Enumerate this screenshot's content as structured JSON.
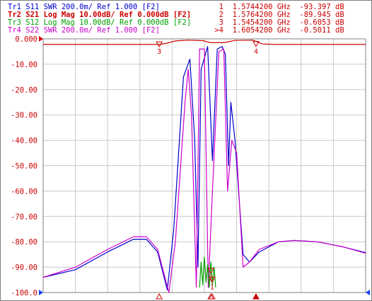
{
  "header": {
    "traces": [
      {
        "id": "Tr1",
        "text": "Tr1 S11 SWR 200.0m/ Ref 1.000 [F2]",
        "color": "#0000cc",
        "active": false
      },
      {
        "id": "Tr2",
        "text": "Tr2 S21 Log Mag 10.00dB/ Ref 0.000dB [F2]",
        "color": "#cc0000",
        "active": true
      },
      {
        "id": "Tr3",
        "text": "Tr3 S12 Log Mag 10.00dB/ Ref 0.000dB [F2]",
        "color": "#00a000",
        "active": false
      },
      {
        "id": "Tr4",
        "text": "Tr4 S22 SWR 200.0m/ Ref 1.000 [F2]",
        "color": "#cc00cc",
        "active": false
      }
    ],
    "markers": [
      {
        "num": "1",
        "freq": "1.5744200 GHz",
        "value": "-93.397 dB"
      },
      {
        "num": "2",
        "freq": "1.5764200 GHz",
        "value": "-89.945 dB"
      },
      {
        "num": "3",
        "freq": "1.5454200 GHz",
        "value": "-0.6053 dB"
      },
      {
        "num": ">4",
        "freq": "1.6054200 GHz",
        "value": "-0.5011 dB"
      }
    ]
  },
  "colors": {
    "s11": "#0000cc",
    "s21": "#cc0000",
    "s12": "#00a000",
    "s22": "#cc00cc",
    "grid": "#c8c8c8",
    "axis_text": "#cc0000",
    "ref_arrow": "#1040ff"
  },
  "chart_data": {
    "type": "line",
    "title": "",
    "xlabel": "",
    "ylabel": "",
    "ylim": [
      -100,
      0
    ],
    "xlim": [
      0,
      10
    ],
    "grid": true,
    "y_ticks": [
      "0.000",
      "-10.00",
      "-20.00",
      "-30.00",
      "-40.00",
      "-50.00",
      "-60.00",
      "-70.00",
      "-80.00",
      "-90.00",
      "-100.0"
    ],
    "series": [
      {
        "name": "S21",
        "color": "#cc0000",
        "points": [
          [
            0,
            -2.2
          ],
          [
            3.6,
            -2.2
          ],
          [
            3.8,
            -1.8
          ],
          [
            4.1,
            -0.8
          ],
          [
            4.5,
            -0.5
          ],
          [
            4.95,
            -0.7
          ],
          [
            5.2,
            -1.5
          ],
          [
            5.6,
            -1.5
          ],
          [
            5.95,
            -0.6
          ],
          [
            6.5,
            -0.5
          ],
          [
            6.8,
            -2
          ],
          [
            7.2,
            -2.2
          ],
          [
            10,
            -2.2
          ]
        ]
      },
      {
        "name": "S11",
        "color": "#0000cc",
        "points": [
          [
            0,
            -94
          ],
          [
            1,
            -91
          ],
          [
            2,
            -84
          ],
          [
            2.8,
            -79
          ],
          [
            3.2,
            -79
          ],
          [
            3.55,
            -84
          ],
          [
            3.85,
            -99
          ],
          [
            4.05,
            -75
          ],
          [
            4.35,
            -15
          ],
          [
            4.55,
            -8
          ],
          [
            4.7,
            -40
          ],
          [
            4.8,
            -90
          ],
          [
            4.9,
            -12
          ],
          [
            5.1,
            -3
          ],
          [
            5.25,
            -48
          ],
          [
            5.4,
            -4
          ],
          [
            5.55,
            -3
          ],
          [
            5.65,
            -6
          ],
          [
            5.75,
            -50
          ],
          [
            5.82,
            -25
          ],
          [
            5.95,
            -40
          ],
          [
            6.2,
            -85
          ],
          [
            6.4,
            -88
          ],
          [
            6.7,
            -84
          ],
          [
            7.3,
            -80
          ],
          [
            7.8,
            -79.5
          ],
          [
            8.5,
            -80
          ],
          [
            9.3,
            -82
          ],
          [
            10,
            -84.3
          ]
        ]
      },
      {
        "name": "S22",
        "color": "#cc00cc",
        "points": [
          [
            0,
            -94
          ],
          [
            1,
            -90
          ],
          [
            2,
            -83
          ],
          [
            2.8,
            -78
          ],
          [
            3.2,
            -78
          ],
          [
            3.55,
            -83
          ],
          [
            3.9,
            -100
          ],
          [
            4.1,
            -80
          ],
          [
            4.4,
            -25
          ],
          [
            4.5,
            -12
          ],
          [
            4.6,
            -30
          ],
          [
            4.75,
            -98
          ],
          [
            4.85,
            -4
          ],
          [
            5.0,
            -4
          ],
          [
            5.12,
            -98
          ],
          [
            5.25,
            -60
          ],
          [
            5.45,
            -5
          ],
          [
            5.6,
            -4
          ],
          [
            5.72,
            -60
          ],
          [
            5.85,
            -40
          ],
          [
            6.0,
            -45
          ],
          [
            6.2,
            -90
          ],
          [
            6.4,
            -88
          ],
          [
            6.7,
            -83
          ],
          [
            7.3,
            -80
          ],
          [
            7.8,
            -79.5
          ],
          [
            8.5,
            -80
          ],
          [
            9.3,
            -82
          ],
          [
            10,
            -84.5
          ]
        ]
      },
      {
        "name": "S12",
        "color": "#00a000",
        "points": [
          [
            4.85,
            -98
          ],
          [
            4.9,
            -88
          ],
          [
            4.95,
            -97
          ],
          [
            5.0,
            -86
          ],
          [
            5.05,
            -96
          ],
          [
            5.1,
            -89
          ],
          [
            5.15,
            -98
          ],
          [
            5.2,
            -88
          ],
          [
            5.25,
            -97
          ],
          [
            5.3,
            -90
          ],
          [
            5.35,
            -98
          ]
        ]
      }
    ],
    "markers": [
      {
        "label": "1",
        "x": 5.24,
        "y": -93.4,
        "series": "S21"
      },
      {
        "label": "2",
        "x": 5.2,
        "y": -89.9,
        "series": "S21"
      },
      {
        "label": "3",
        "x": 3.6,
        "y": -0.6,
        "series": "S21"
      },
      {
        "label": "4",
        "x": 6.6,
        "y": -0.5,
        "series": "S21"
      }
    ]
  }
}
